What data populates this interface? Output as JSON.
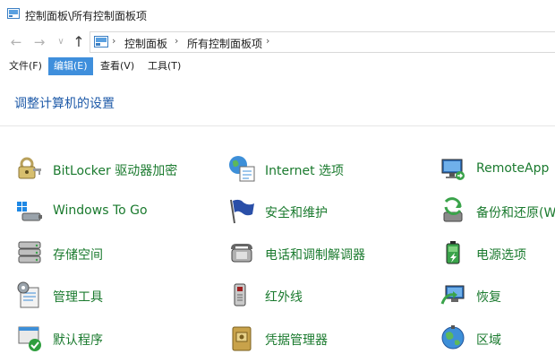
{
  "window": {
    "title": "控制面板\\所有控制面板项"
  },
  "address_bar": {
    "crumbs": [
      "控制面板",
      "所有控制面板项"
    ]
  },
  "menu": [
    {
      "label": "文件(F)"
    },
    {
      "label": "编辑(E)",
      "active": true
    },
    {
      "label": "查看(V)"
    },
    {
      "label": "工具(T)"
    }
  ],
  "heading": "调整计算机的设置",
  "items": [
    {
      "label": "BitLocker 驱动器加密",
      "icon": "bitlocker-icon"
    },
    {
      "label": "Internet 选项",
      "icon": "internet-options-icon"
    },
    {
      "label": "RemoteApp",
      "icon": "remoteapp-icon"
    },
    {
      "label": "Windows To Go",
      "icon": "windows-to-go-icon"
    },
    {
      "label": "安全和维护",
      "icon": "security-maintenance-icon"
    },
    {
      "label": "备份和还原(W",
      "icon": "backup-restore-icon"
    },
    {
      "label": "存储空间",
      "icon": "storage-spaces-icon"
    },
    {
      "label": "电话和调制解调器",
      "icon": "phone-modem-icon"
    },
    {
      "label": "电源选项",
      "icon": "power-options-icon"
    },
    {
      "label": "管理工具",
      "icon": "admin-tools-icon"
    },
    {
      "label": "红外线",
      "icon": "infrared-icon"
    },
    {
      "label": "恢复",
      "icon": "recovery-icon"
    },
    {
      "label": "默认程序",
      "icon": "default-programs-icon"
    },
    {
      "label": "凭据管理器",
      "icon": "credential-manager-icon"
    },
    {
      "label": "区域",
      "icon": "region-icon"
    }
  ],
  "colors": {
    "link_green": "#1a7a2e",
    "heading_blue": "#1e5aa8",
    "menu_active": "#3f8fdc"
  }
}
